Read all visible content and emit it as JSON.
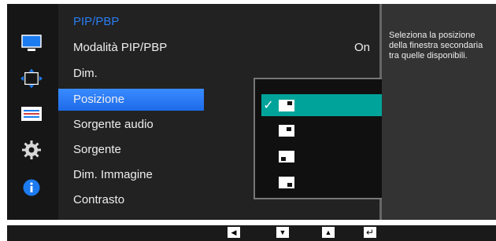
{
  "menu": {
    "title": "PIP/PBP",
    "items": [
      {
        "label": "Modalità PIP/PBP",
        "value": "On"
      },
      {
        "label": "Dim."
      },
      {
        "label": "Posizione",
        "selected": true
      },
      {
        "label": "Sorgente audio"
      },
      {
        "label": "Sorgente"
      },
      {
        "label": "Dim. Immagine"
      },
      {
        "label": "Contrasto"
      }
    ]
  },
  "sidebar": {
    "icons": [
      "monitor-icon",
      "move-arrows-icon",
      "sliders-icon",
      "gear-icon",
      "info-icon"
    ],
    "accent": "#1d7bf0"
  },
  "submenu": {
    "options": [
      {
        "corner": "top-right",
        "checked": true
      },
      {
        "corner": "top-right-small"
      },
      {
        "corner": "bottom-left"
      },
      {
        "corner": "bottom-right"
      }
    ],
    "selected_color": "#00a39a"
  },
  "info": {
    "text": "Seleziona la posizione della finestra secondaria tra quelle disponibili."
  },
  "footer": {
    "buttons": [
      "left-arrow-icon",
      "down-arrow-icon",
      "up-arrow-icon",
      "enter-icon"
    ]
  }
}
